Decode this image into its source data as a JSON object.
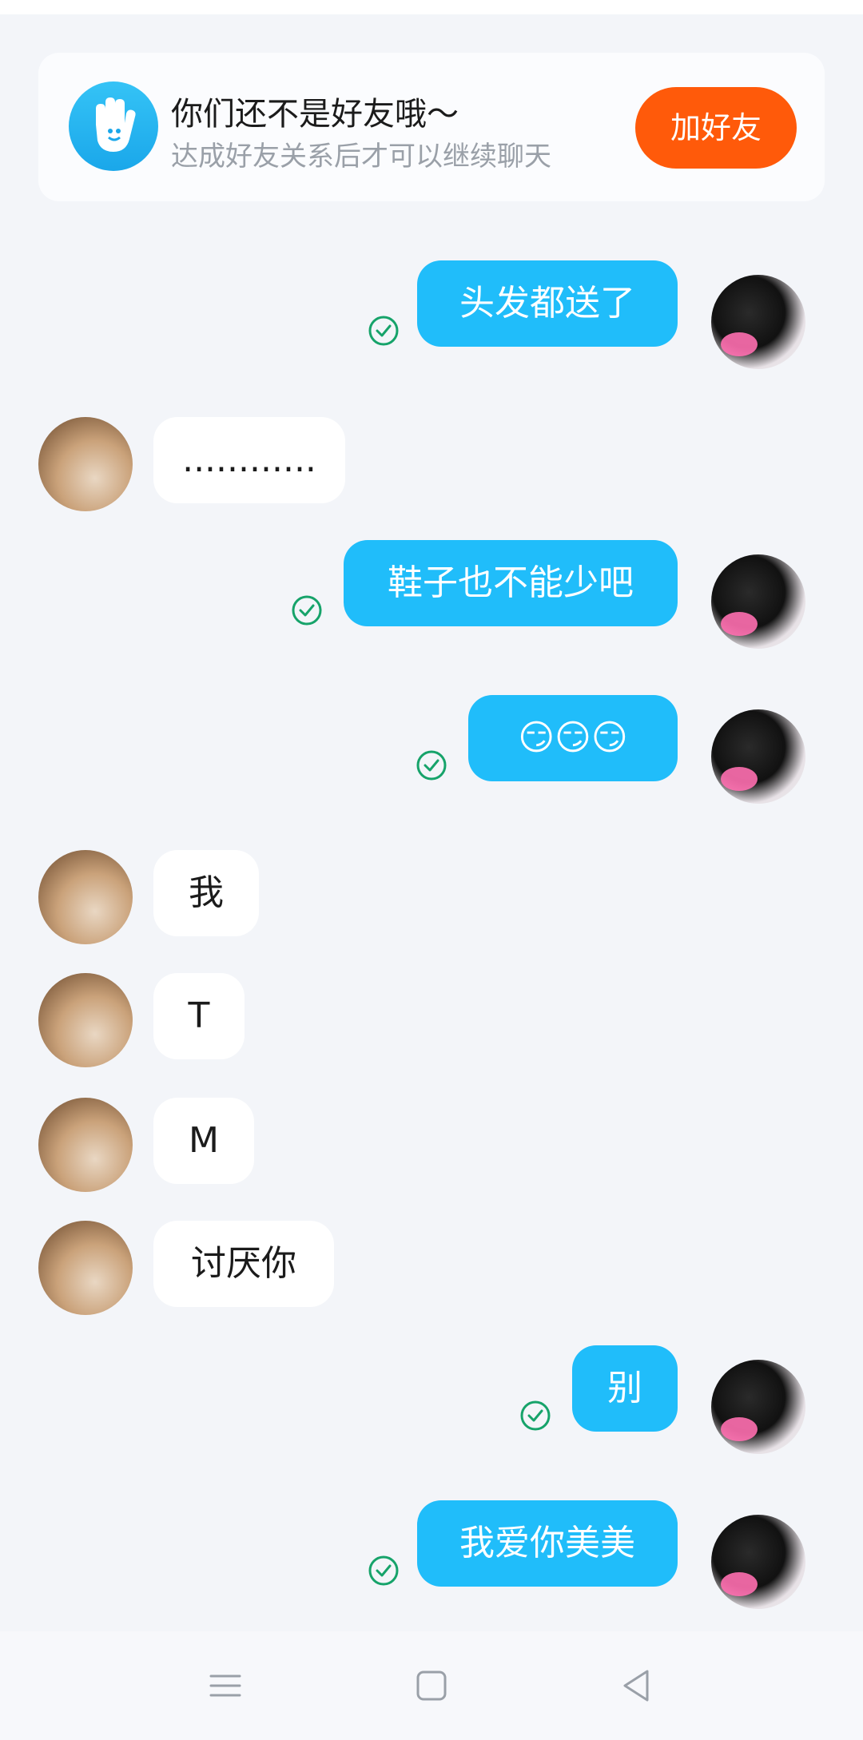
{
  "banner": {
    "title": "你们还不是好友哦～",
    "subtitle": "达成好友关系后才可以继续聊天",
    "add_label": "加好友",
    "icon": "hand-wave-icon"
  },
  "messages": [
    {
      "from": "me",
      "text": "头发都送了",
      "status": "sent-check-icon"
    },
    {
      "from": "them",
      "text": "............"
    },
    {
      "from": "me",
      "text": "鞋子也不能少吧",
      "status": "sent-check-icon"
    },
    {
      "from": "me",
      "text": "😏😏😏",
      "status": "sent-check-icon"
    },
    {
      "from": "them",
      "text": "我"
    },
    {
      "from": "them",
      "text": "T"
    },
    {
      "from": "them",
      "text": "M"
    },
    {
      "from": "them",
      "text": "讨厌你"
    },
    {
      "from": "me",
      "text": "别",
      "status": "sent-check-icon"
    },
    {
      "from": "me",
      "text": "我爱你美美",
      "status": "sent-check-icon"
    }
  ],
  "navbar": {
    "items": [
      "menu-icon",
      "home-square-icon",
      "back-triangle-icon"
    ]
  },
  "colors": {
    "accent_blue": "#20bdfa",
    "button_orange": "#ff5a0a",
    "check_green": "#16a36a",
    "background": "#f3f5f9"
  }
}
